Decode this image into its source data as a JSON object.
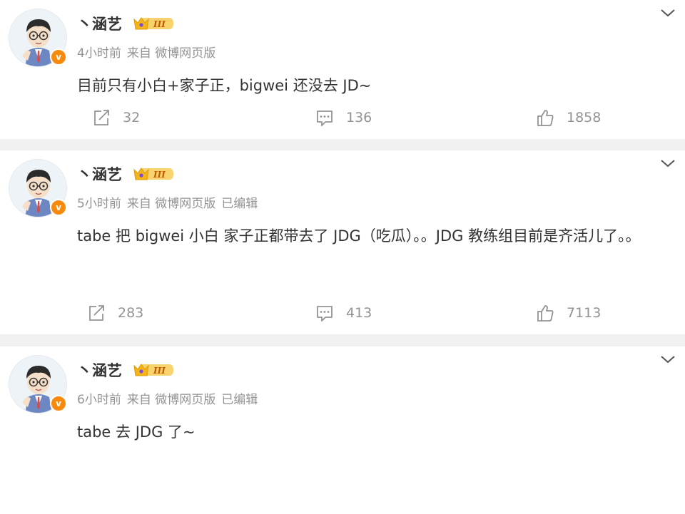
{
  "posts": [
    {
      "username": "丶涵艺",
      "level": "III",
      "verified_badge": "v",
      "time": "4小时前",
      "source": "来自 微博网页版",
      "edited": "",
      "content": "目前只有小白+家子正，bigwei 还没去 JD~",
      "reposts": "32",
      "comments": "136",
      "likes": "1858"
    },
    {
      "username": "丶涵艺",
      "level": "III",
      "verified_badge": "v",
      "time": "5小时前",
      "source": "来自 微博网页版",
      "edited": "已编辑",
      "content": "tabe 把 bigwei 小白 家子正都带去了 JDG（吃瓜）。。JDG 教练组目前是齐活儿了。。",
      "reposts": "283",
      "comments": "413",
      "likes": "7113"
    },
    {
      "username": "丶涵艺",
      "level": "III",
      "verified_badge": "v",
      "time": "6小时前",
      "source": "来自 微博网页版",
      "edited": "已编辑",
      "content": "tabe 去 JDG 了~",
      "reposts": "",
      "comments": "",
      "likes": ""
    }
  ],
  "colors": {
    "badge_orange": "#f78a0c",
    "meta_gray": "#939393",
    "level_gold": "#f3b519"
  },
  "icons": [
    "chevron-down-icon",
    "repost-icon",
    "comment-icon",
    "like-icon",
    "avatar",
    "verified-icon",
    "level-crown-icon"
  ]
}
